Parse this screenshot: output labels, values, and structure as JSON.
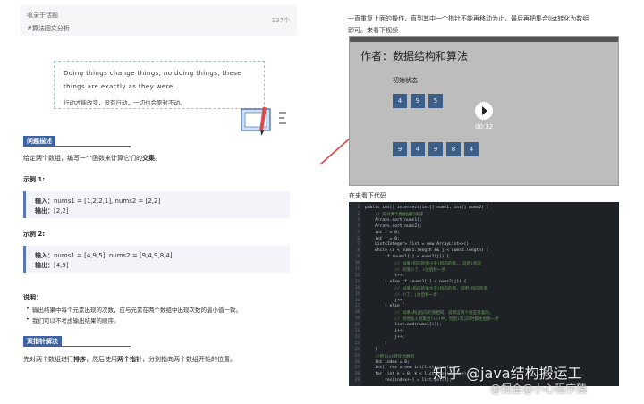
{
  "collect": {
    "title": "收录于话题",
    "tag": "#算法图文分析",
    "count": "137个"
  },
  "quote": {
    "en_line1": "Doing things change things, no doing things, these",
    "en_line2": "things are exactly as they were.",
    "cn": "行动才能改变，没有行动，一切也会原封不动。"
  },
  "problem": {
    "heading": "问题描述",
    "desc_prefix": "给定两个数组，编写一个函数来计算它们的",
    "desc_bold": "交集",
    "desc_suffix": "。"
  },
  "example1": {
    "heading": "示例 1:",
    "input_label": "输入：",
    "input_value": "nums1 = [1,2,2,1], nums2 = [2,2]",
    "output_label": "输出：",
    "output_value": "[2,2]"
  },
  "example2": {
    "heading": "示例 2:",
    "input_label": "输入：",
    "input_value": "nums1 = [4,9,5], nums2 = [9,4,9,8,4]",
    "output_label": "输出：",
    "output_value": "[4,9]"
  },
  "notes": {
    "heading": "说明：",
    "items": [
      "输出结果中每个元素出现的次数，应与元素在两个数组中出现次数的最小值一致。",
      "我们可以不考虑输出结果的顺序。"
    ]
  },
  "solution": {
    "heading": "双指针解决",
    "p_prefix": "先对两个数组进行",
    "p_bold1": "排序",
    "p_mid": "，然后使用",
    "p_bold2": "两个指针",
    "p_suffix": "，分别指向两个数组开始的位置。"
  },
  "right": {
    "para_line1": "一直重复上面的操作，直到其中一个指针不能再移动为止，最后再把集合list转化为数组",
    "para_line2": "即可。来看下视频",
    "code_label": "在来看下代码"
  },
  "video": {
    "title": "作者：数据结构和算法",
    "state": "初始状态",
    "row1": [
      "4",
      "9",
      "5"
    ],
    "row2": [
      "9",
      "4",
      "9",
      "8",
      "4"
    ],
    "time": "00:32"
  },
  "code_lines": [
    "public int[] intersect(int[] nums1, int[] nums2) {",
    "    // 先对两个数组进行排序",
    "    Arrays.sort(nums1);",
    "    Arrays.sort(nums2);",
    "    int i = 0;",
    "    int j = 0;",
    "    List<Integer> list = new ArrayList<>();",
    "    while (i < nums1.length && j < nums2.length) {",
    "        if (nums1[i] < nums2[j]) {",
    "            // 如果i指向的值小于j指向的值，，说明i指向",
    "            // 的值小了，i往后移一步",
    "            i++;",
    "        } else if (nums1[i] > nums2[j]) {",
    "            // 如果i指向的值大于j指向的值，说明j指向的值",
    "            // 小了，j往后移一步",
    "            j++;",
    "        } else {",
    "            // 如果i和j指向的值相同，说明这两个值是重复的，",
    "            // 把他加入到集合list中，然后i和j同时都往后移一步",
    "            list.add(nums1[i]);",
    "            i++;",
    "            j++;",
    "        }",
    "    }",
    "    //把list转化为数组",
    "    int index = 0;",
    "    int[] res = new int[list.size()];",
    "    for (int k = 0; k < list.size(); k++) {",
    "        res[index++] = list.get(k);"
  ],
  "watermark": {
    "line1": "知乎 @java结构搬运工",
    "line2": "@掘金@小心程序猿"
  },
  "colors": {
    "accent": "#3b63a8",
    "code_bg": "#1e2227",
    "video_bg": "#bdbdbd",
    "cell": "#3c5f8a",
    "arrow": "#e04343"
  }
}
